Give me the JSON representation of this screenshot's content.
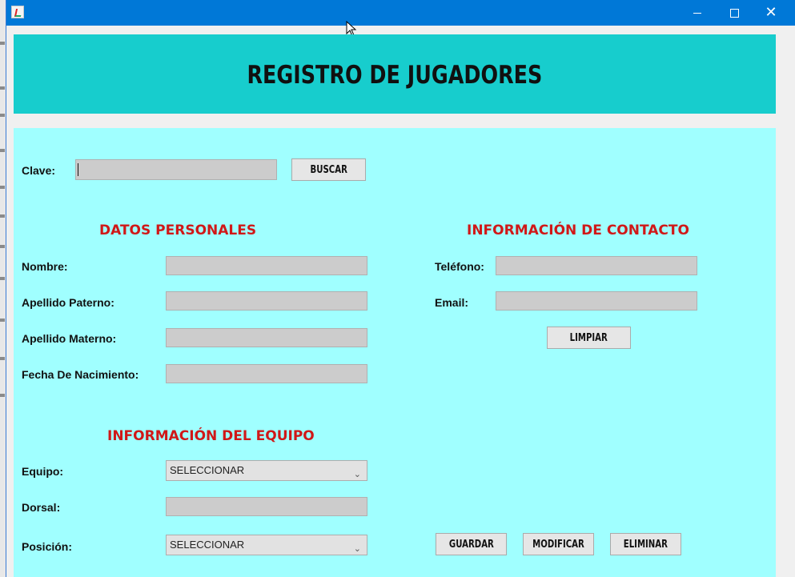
{
  "window": {
    "title": "",
    "controls": {
      "minimize": "minimize-icon",
      "maximize": "maximize-icon",
      "close": "close-icon"
    }
  },
  "header": {
    "title": "REGISTRO DE JUGADORES"
  },
  "search": {
    "label": "Clave:",
    "value": "",
    "button": "BUSCAR"
  },
  "personal": {
    "title": "DATOS PERSONALES",
    "nombre_label": "Nombre:",
    "nombre_value": "",
    "paterno_label": "Apellido Paterno:",
    "paterno_value": "",
    "materno_label": "Apellido Materno:",
    "materno_value": "",
    "fecha_label": "Fecha De Nacimiento:",
    "fecha_value": ""
  },
  "contact": {
    "title": "INFORMACIÓN DE CONTACTO",
    "telefono_label": "Teléfono:",
    "telefono_value": "",
    "email_label": "Email:",
    "email_value": "",
    "clear_button": "LIMPIAR"
  },
  "team": {
    "title": "INFORMACIÓN DEL EQUIPO",
    "equipo_label": "Equipo:",
    "equipo_selected": "SELECCIONAR",
    "dorsal_label": "Dorsal:",
    "dorsal_value": "",
    "posicion_label": "Posición:",
    "posicion_selected": "SELECCIONAR"
  },
  "actions": {
    "save": "GUARDAR",
    "modify": "MODIFICAR",
    "delete": "ELIMINAR"
  },
  "colors": {
    "titlebar": "#0078d7",
    "header_bg": "#17cdcd",
    "panel_bg": "#a0ffff",
    "section_title": "#d01818",
    "field_bg": "#cccccc"
  }
}
